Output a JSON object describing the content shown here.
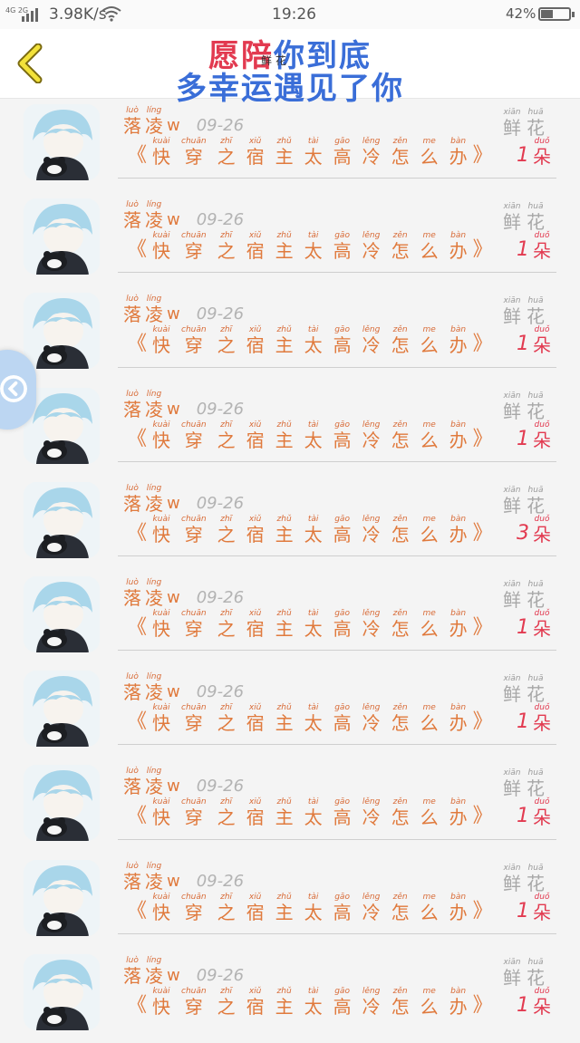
{
  "status_bar": {
    "network": "4G 2G",
    "speed": "3.98K/s",
    "time": "19:26",
    "battery_pct": "42%",
    "battery_level": 0.42
  },
  "header": {
    "title_line1_red": "愿陪",
    "title_line1_blue": "你到底",
    "title_sub": "鲜 花",
    "title_line2": "多幸运遇见了你"
  },
  "labels": {
    "open_quote": "《",
    "close_quote": "》",
    "flower_py_1": "xiān",
    "flower_hz_1": "鲜",
    "flower_py_2": "huā",
    "flower_hz_2": "花",
    "unit_py": "duǒ",
    "unit_hz": "朵"
  },
  "book_title": [
    {
      "py": "kuài",
      "hz": "快"
    },
    {
      "py": "chuān",
      "hz": "穿"
    },
    {
      "py": "zhī",
      "hz": "之"
    },
    {
      "py": "xiǔ",
      "hz": "宿"
    },
    {
      "py": "zhǔ",
      "hz": "主"
    },
    {
      "py": "tài",
      "hz": "太"
    },
    {
      "py": "gāo",
      "hz": "高"
    },
    {
      "py": "lěng",
      "hz": "冷"
    },
    {
      "py": "zěn",
      "hz": "怎"
    },
    {
      "py": "me",
      "hz": "么"
    },
    {
      "py": "bàn",
      "hz": "办"
    }
  ],
  "records": [
    {
      "name_py_1": "luò",
      "name_hz_1": "落",
      "name_py_2": "líng",
      "name_hz_2": "凌",
      "name_suffix": "w",
      "date": "09-26",
      "count": "1"
    },
    {
      "name_py_1": "luò",
      "name_hz_1": "落",
      "name_py_2": "líng",
      "name_hz_2": "凌",
      "name_suffix": "w",
      "date": "09-26",
      "count": "1"
    },
    {
      "name_py_1": "luò",
      "name_hz_1": "落",
      "name_py_2": "líng",
      "name_hz_2": "凌",
      "name_suffix": "w",
      "date": "09-26",
      "count": "1"
    },
    {
      "name_py_1": "luò",
      "name_hz_1": "落",
      "name_py_2": "líng",
      "name_hz_2": "凌",
      "name_suffix": "w",
      "date": "09-26",
      "count": "1"
    },
    {
      "name_py_1": "luò",
      "name_hz_1": "落",
      "name_py_2": "líng",
      "name_hz_2": "凌",
      "name_suffix": "w",
      "date": "09-26",
      "count": "3"
    },
    {
      "name_py_1": "luò",
      "name_hz_1": "落",
      "name_py_2": "líng",
      "name_hz_2": "凌",
      "name_suffix": "w",
      "date": "09-26",
      "count": "1"
    },
    {
      "name_py_1": "luò",
      "name_hz_1": "落",
      "name_py_2": "líng",
      "name_hz_2": "凌",
      "name_suffix": "w",
      "date": "09-26",
      "count": "1"
    },
    {
      "name_py_1": "luò",
      "name_hz_1": "落",
      "name_py_2": "líng",
      "name_hz_2": "凌",
      "name_suffix": "w",
      "date": "09-26",
      "count": "1"
    },
    {
      "name_py_1": "luò",
      "name_hz_1": "落",
      "name_py_2": "líng",
      "name_hz_2": "凌",
      "name_suffix": "w",
      "date": "09-26",
      "count": "1"
    },
    {
      "name_py_1": "luò",
      "name_hz_1": "落",
      "name_py_2": "líng",
      "name_hz_2": "凌",
      "name_suffix": "w",
      "date": "09-26",
      "count": "1"
    }
  ],
  "icons": {
    "back": "chevron-left-icon",
    "wifi": "wifi-icon",
    "battery": "battery-icon",
    "side": "collapse-icon"
  },
  "colors": {
    "accent_orange": "#e07a3d",
    "count_red": "#e23a50",
    "title_blue": "#3a6ed8"
  }
}
